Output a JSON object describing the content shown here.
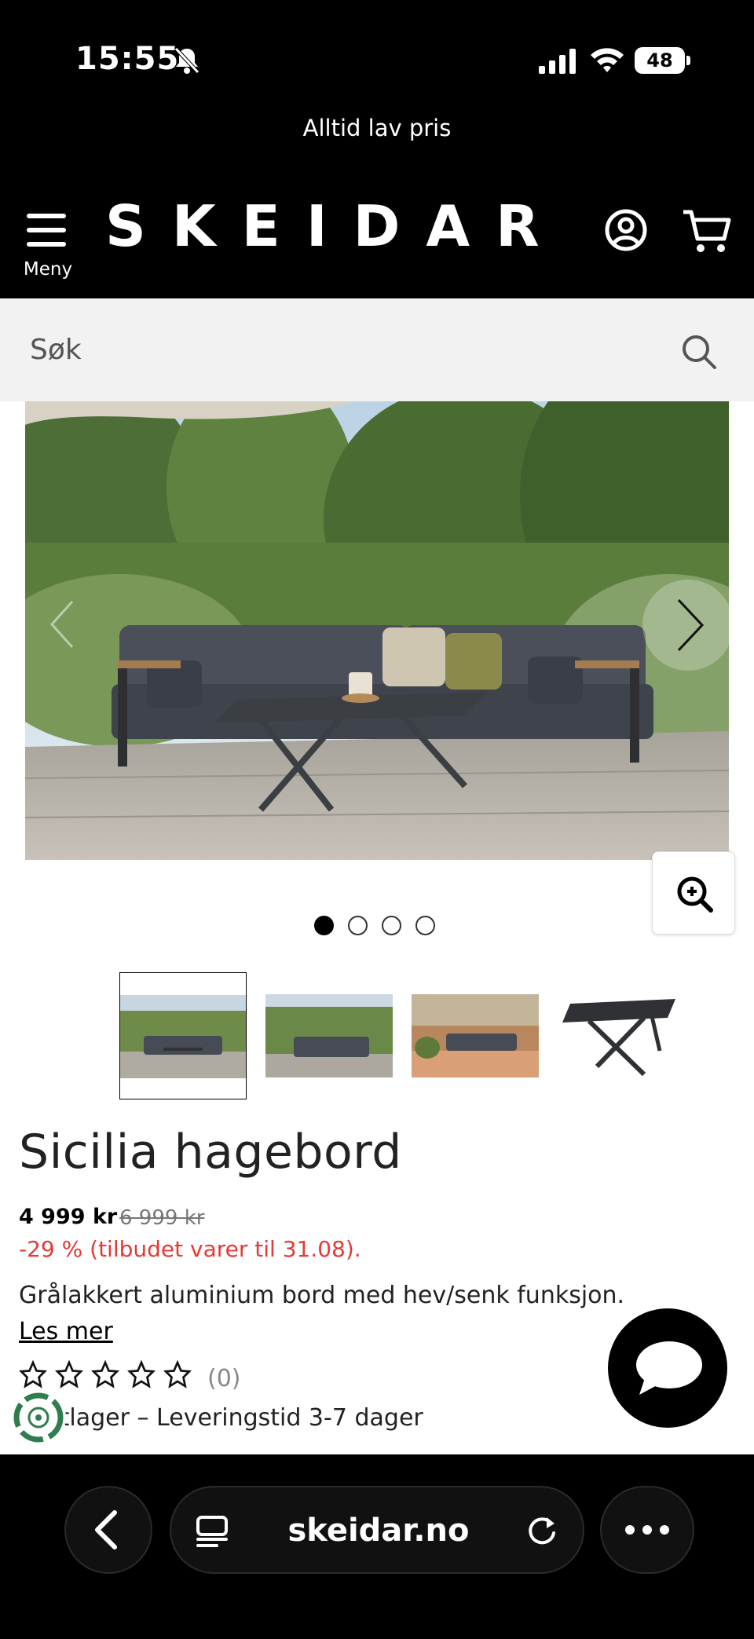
{
  "status_bar": {
    "time": "15:55",
    "battery": "48"
  },
  "promo": {
    "text": "Alltid lav pris"
  },
  "header": {
    "logo": "SKEIDAR",
    "menu_label": "Meny"
  },
  "search": {
    "placeholder": "Søk"
  },
  "gallery": {
    "image_count": 4,
    "active_index": 0
  },
  "product": {
    "title": "Sicilia hagebord",
    "price": "4 999 kr",
    "old_price": "6 999 kr",
    "discount": "-29 % (tilbudet varer til 31.08).",
    "description": "Grålakkert aluminium bord med hev/senk funksjon.",
    "read_more": "Les mer",
    "rating": 0,
    "rating_max": 5,
    "review_count": "(0)",
    "stock": "Nettlager – Leveringstid 3-7 dager"
  },
  "browser": {
    "url": "skeidar.no"
  },
  "colors": {
    "discount": "#e53935",
    "header_bg": "#000000",
    "search_bg": "#f2f2f2"
  }
}
